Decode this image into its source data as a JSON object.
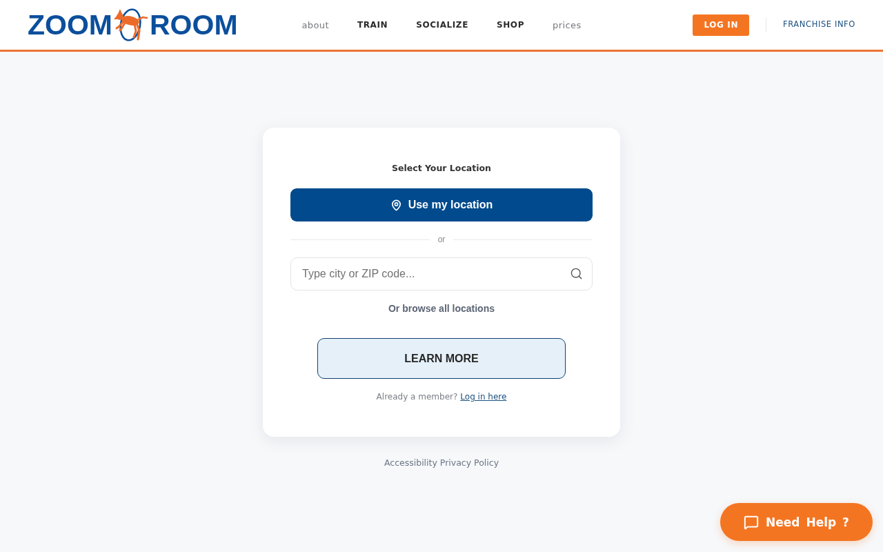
{
  "header": {
    "logo": {
      "words": [
        "ZOOM",
        "ROOM"
      ]
    },
    "nav": [
      {
        "label": "about",
        "kind": "plain"
      },
      {
        "label": "TRAIN",
        "kind": "bold"
      },
      {
        "label": "SOCIALIZE",
        "kind": "bold"
      },
      {
        "label": "SHOP",
        "kind": "bold"
      },
      {
        "label": "prices",
        "kind": "plain"
      }
    ],
    "login_button": "LOG IN",
    "franchise_link": "FRANCHISE INFO"
  },
  "location_card": {
    "title": "Select Your Location",
    "use_location_button": "Use my location",
    "divider": "or",
    "search": {
      "placeholder": "Type city or ZIP code..."
    },
    "browse_link": "Or browse all locations",
    "learn_more_button": "LEARN MORE",
    "member_prompt": {
      "text": "Already a member?",
      "link": "Log in here"
    }
  },
  "footer": {
    "links": [
      "Accessibility",
      "Privacy Policy"
    ]
  },
  "help_button": "Need Help ?"
}
